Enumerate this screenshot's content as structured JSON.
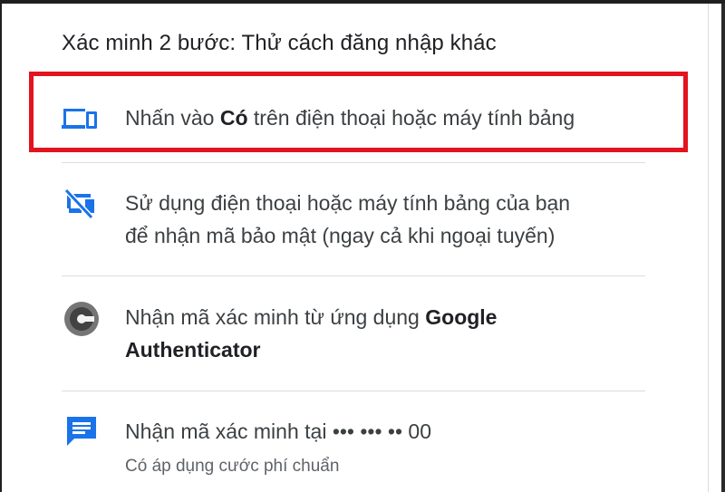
{
  "title": "Xác minh 2 bước: Thử cách đăng nhập khác",
  "options": [
    {
      "icon": "devices-icon",
      "before": "Nhấn vào ",
      "bold": "Có",
      "after": " trên điện thoại hoặc máy tính bảng"
    },
    {
      "icon": "phonelink-off-icon",
      "line1": "Sử dụng điện thoại hoặc máy tính bảng của bạn",
      "line2": "để nhận mã bảo mật (ngay cả khi ngoại tuyến)"
    },
    {
      "icon": "google-authenticator-icon",
      "before": "Nhận mã xác minh từ ứng dụng ",
      "bold1": "Google",
      "bold2": "Authenticator"
    },
    {
      "icon": "sms-icon",
      "text": "Nhận mã xác minh tại ••• ••• •• 00",
      "subtext": "Có áp dụng cước phí chuẩn"
    }
  ],
  "colors": {
    "accent": "#1a73e8",
    "highlight": "#e3141e",
    "text": "#3c4043",
    "subtext": "#5f6368",
    "divider": "#dadce0"
  }
}
